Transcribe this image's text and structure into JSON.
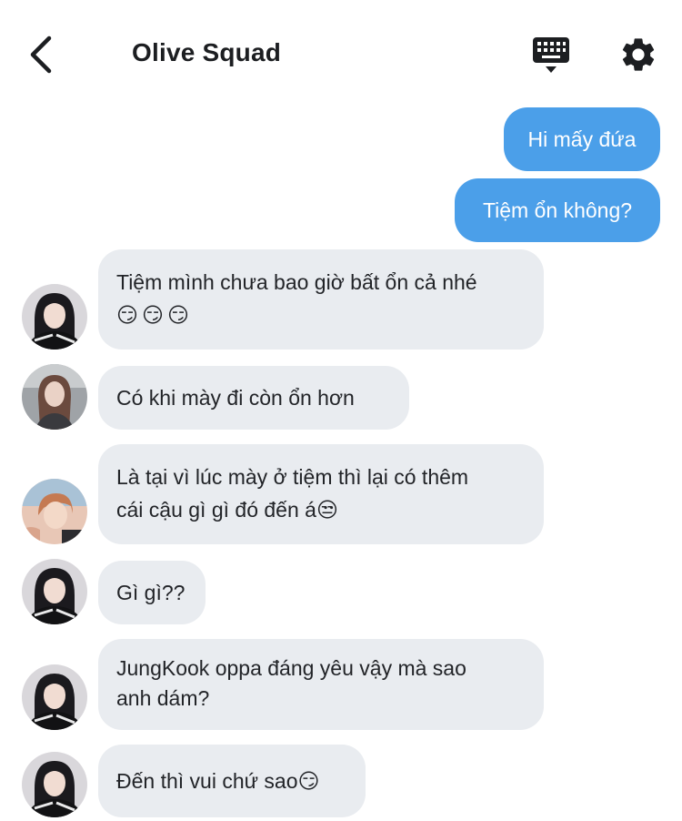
{
  "header": {
    "title": "Olive Squad",
    "back_icon": "chevron-left-icon",
    "keyboard_icon": "keyboard-icon",
    "settings_icon": "gear-icon"
  },
  "colors": {
    "outgoing_bubble": "#4b9fe9",
    "incoming_bubble": "#e9ecf0",
    "text": "#1c1e21"
  },
  "messages": [
    {
      "direction": "outgoing",
      "text": "Hi mấy đứa"
    },
    {
      "direction": "outgoing",
      "text": "Tiệm ổn không?"
    },
    {
      "direction": "incoming",
      "avatar": "girl-black-hair",
      "lines": [
        "Tiệm mình chưa bao giờ bất ổn cả nhé",
        "😏😏😏"
      ]
    },
    {
      "direction": "incoming",
      "avatar": "girl-long-hair",
      "lines": [
        "Có khi mày đi còn ổn hơn"
      ]
    },
    {
      "direction": "incoming",
      "avatar": "boy-light",
      "lines": [
        "Là tại vì lúc mày ở tiệm thì lại có thêm",
        "cái cậu gì gì đó đến á😒"
      ]
    },
    {
      "direction": "incoming",
      "avatar": "girl-black-hair",
      "lines": [
        "Gì gì??"
      ]
    },
    {
      "direction": "incoming",
      "avatar": "girl-black-hair",
      "lines": [
        "JungKook oppa đáng yêu vậy mà sao",
        "anh dám?"
      ]
    },
    {
      "direction": "incoming",
      "avatar": "girl-black-hair",
      "lines": [
        "Đến thì vui chứ sao😏"
      ]
    }
  ]
}
